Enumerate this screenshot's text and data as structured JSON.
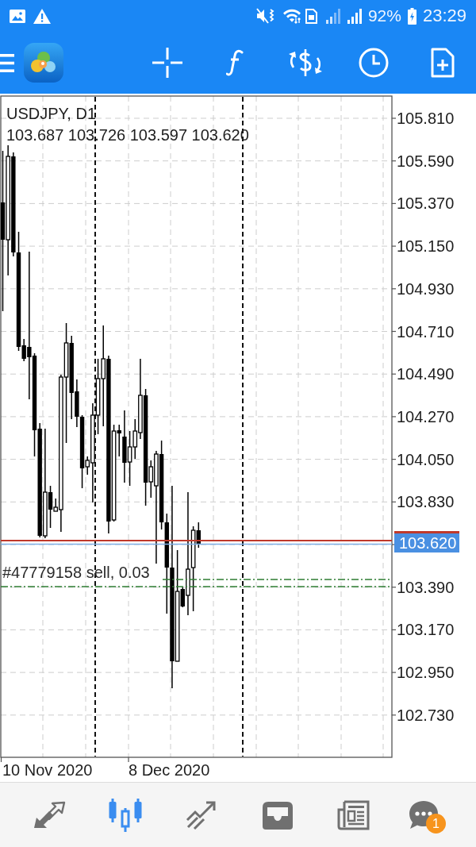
{
  "status_bar": {
    "battery": "92%",
    "time": "23:29"
  },
  "chart": {
    "symbol": "USDJPY, D1",
    "ohlc": "103.687 103.726 103.597 103.620",
    "price_labels": [
      "105.810",
      "105.590",
      "105.370",
      "105.150",
      "104.930",
      "104.710",
      "104.490",
      "104.270",
      "104.050",
      "103.830",
      "103.390",
      "103.170",
      "102.950",
      "102.730"
    ],
    "current_price": "103.620",
    "order_label": "#47779158 sell, 0.03",
    "date_labels": [
      "10 Nov 2020",
      "8 Dec 2020"
    ]
  },
  "bottom_nav": {
    "items": [
      {
        "selected": false
      },
      {
        "selected": true
      },
      {
        "selected": false
      },
      {
        "selected": false
      },
      {
        "selected": false
      },
      {
        "selected": false,
        "badge": "1"
      }
    ]
  }
}
